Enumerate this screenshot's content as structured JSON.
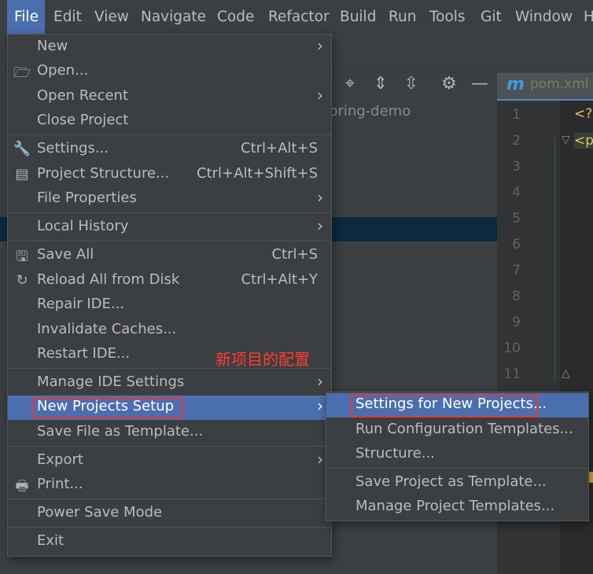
{
  "menubar": {
    "items": [
      "File",
      "Edit",
      "View",
      "Navigate",
      "Code",
      "Refactor",
      "Build",
      "Run",
      "Tools",
      "Git",
      "Window",
      "H"
    ]
  },
  "project": {
    "name": "pring-demo"
  },
  "editor": {
    "tab": {
      "icon": "maven-icon",
      "title": "pom.xml",
      "icon_glyph": "m"
    },
    "line_numbers": [
      "1",
      "2",
      "3",
      "4",
      "5",
      "6",
      "7",
      "8",
      "9",
      "10",
      "11"
    ],
    "code": {
      "line1": "<?",
      "line2": "<p"
    }
  },
  "file_menu": {
    "items": [
      {
        "label": "New",
        "submenu": true
      },
      {
        "label": "Open...",
        "icon": "folder-open-icon"
      },
      {
        "label": "Open Recent",
        "submenu": true
      },
      {
        "label": "Close Project"
      },
      {
        "label": "Settings...",
        "icon": "wrench-icon",
        "shortcut": "Ctrl+Alt+S"
      },
      {
        "label": "Project Structure...",
        "icon": "project-structure-icon",
        "shortcut": "Ctrl+Alt+Shift+S"
      },
      {
        "label": "File Properties",
        "submenu": true
      },
      {
        "label": "Local History",
        "submenu": true
      },
      {
        "label": "Save All",
        "icon": "save-icon",
        "shortcut": "Ctrl+S"
      },
      {
        "label": "Reload All from Disk",
        "icon": "reload-icon",
        "shortcut": "Ctrl+Alt+Y"
      },
      {
        "label": "Repair IDE..."
      },
      {
        "label": "Invalidate Caches..."
      },
      {
        "label": "Restart IDE..."
      },
      {
        "label": "Manage IDE Settings",
        "submenu": true
      },
      {
        "label": "New Projects Setup",
        "submenu": true,
        "selected": true
      },
      {
        "label": "Save File as Template..."
      },
      {
        "label": "Export",
        "submenu": true
      },
      {
        "label": "Print...",
        "icon": "print-icon"
      },
      {
        "label": "Power Save Mode"
      },
      {
        "label": "Exit"
      }
    ]
  },
  "submenu": {
    "items": [
      {
        "label": "Settings for New Projects...",
        "selected": true
      },
      {
        "label": "Run Configuration Templates..."
      },
      {
        "label": "Structure..."
      },
      {
        "label": "Save Project as Template..."
      },
      {
        "label": "Manage Project Templates..."
      }
    ]
  },
  "annotation": {
    "text": "新项目的配置"
  },
  "colors": {
    "selection": "#4b6eaf",
    "highlight_box": "#e53935",
    "annotation_text": "#ff3b30"
  }
}
